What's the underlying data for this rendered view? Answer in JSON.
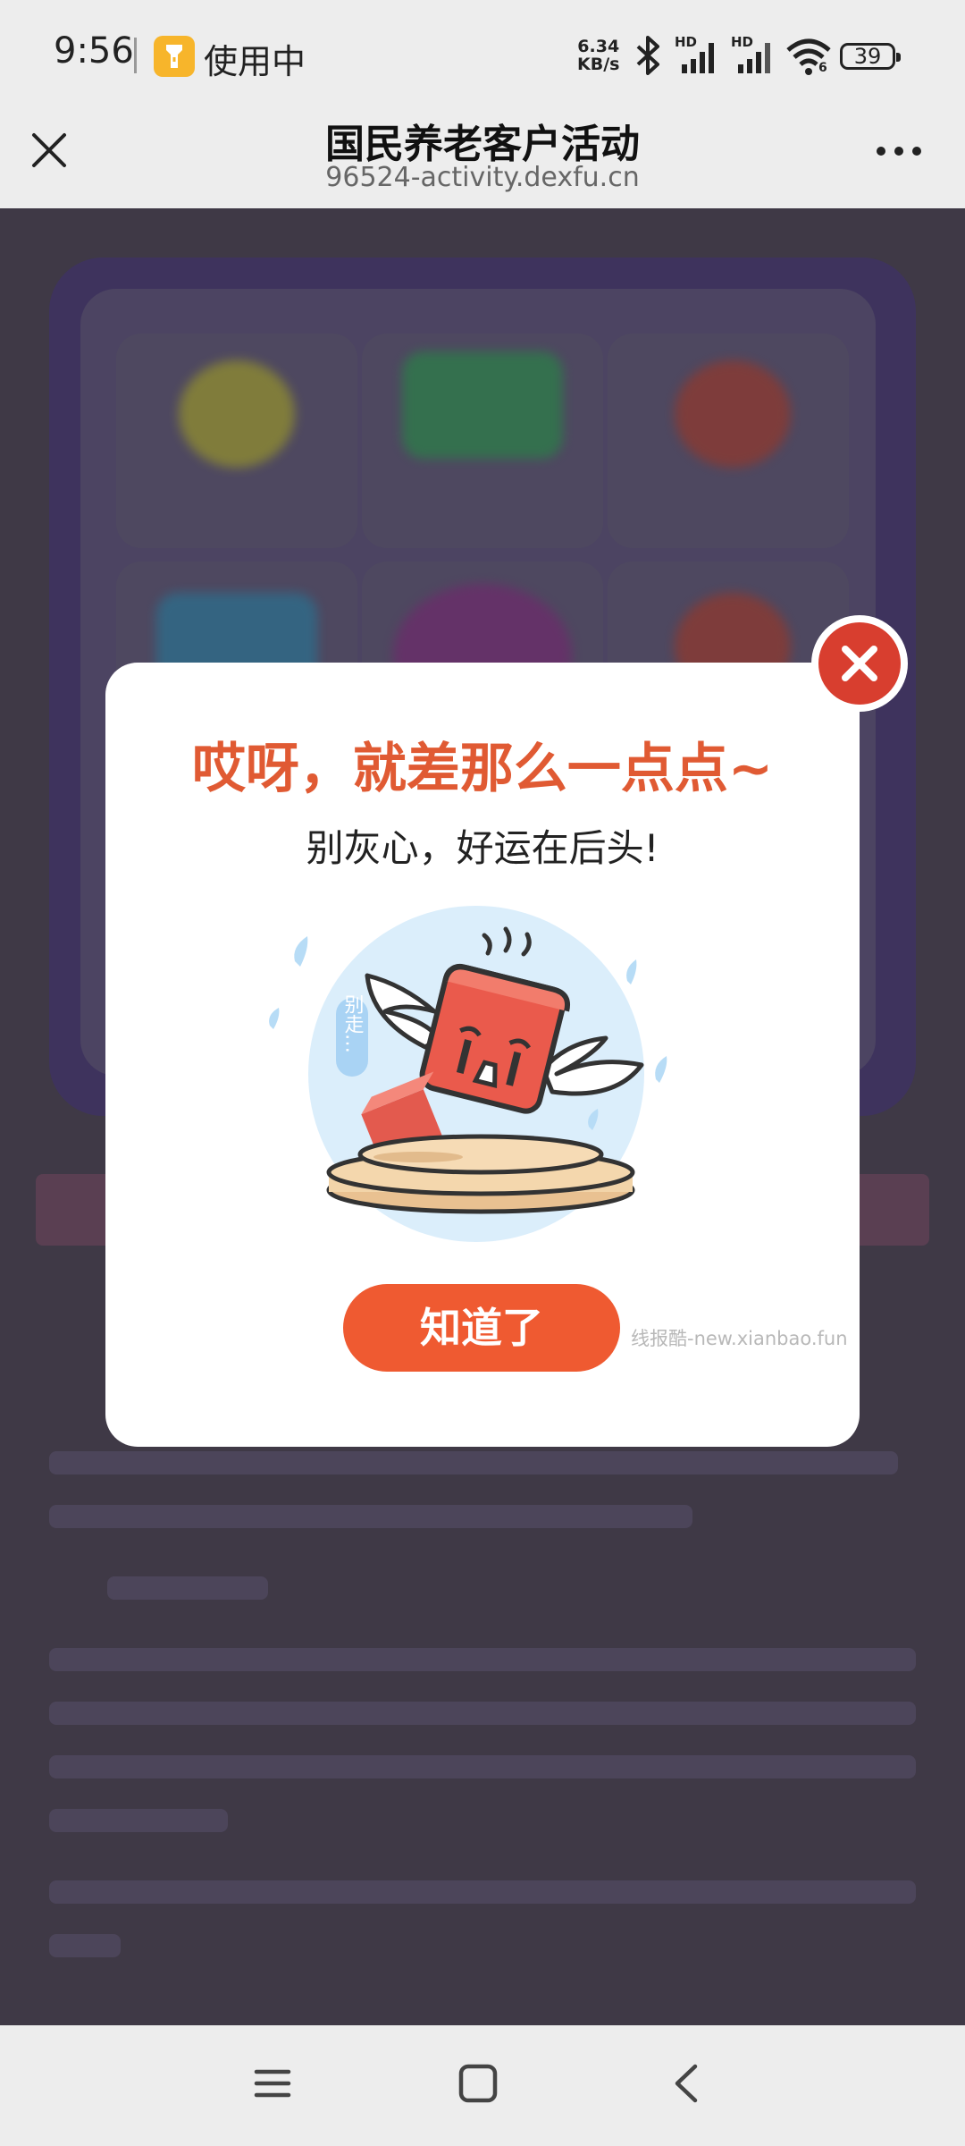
{
  "status_bar": {
    "time": "9:56",
    "app_usage": "使用中",
    "net_speed_value": "6.34",
    "net_speed_unit": "KB/s",
    "signal_label_1": "HD",
    "signal_label_2": "HD",
    "wifi_label": "6",
    "battery": "39",
    "icons": [
      "flashlight-icon",
      "bluetooth-icon",
      "signal-icon",
      "signal-icon",
      "wifi-icon",
      "battery-icon"
    ]
  },
  "browser": {
    "title": "国民养老客户活动",
    "url": "96524-activity.dexfu.cn",
    "close_icon": "close-icon",
    "more_icon": "more-icon"
  },
  "dialog": {
    "title": "哎呀，就差那么一点点~",
    "subtitle": "别灰心，好运在后头!",
    "illustration_caption": "别走…",
    "confirm_label": "知道了",
    "watermark": "线报酷-new.xianbao.fun",
    "close_icon": "close-circle-icon",
    "title_color": "#e05a33",
    "button_color": "#ef5a31",
    "close_color": "#d83e2f"
  },
  "nav_bar": {
    "icons": [
      "menu-icon",
      "home-icon",
      "back-icon"
    ]
  }
}
